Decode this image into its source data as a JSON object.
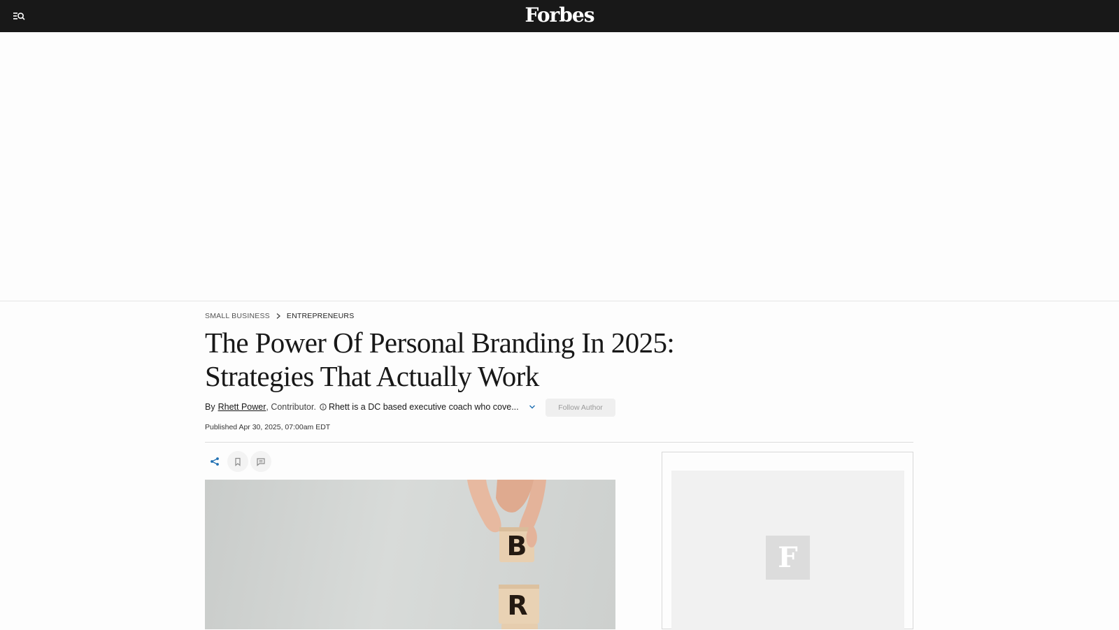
{
  "header": {
    "logo_text": "Forbes",
    "menu_icon": "menu-search-icon",
    "background": "#181818"
  },
  "breadcrumb": {
    "section": "SMALL BUSINESS",
    "separator_icon": "chevron-right-icon",
    "subsection": "ENTREPRENEURS"
  },
  "article": {
    "headline": "The Power Of Personal Branding In 2025: Strategies That Actually Work",
    "byline": {
      "prefix": "By",
      "author_name": "Rhett Power",
      "role": ", Contributor.",
      "info_icon": "info-circle-icon",
      "bio": "Rhett is a DC based executive coach who cove...",
      "expand_icon": "chevron-down-icon",
      "follow_label": "Follow Author"
    },
    "published": "Published Apr 30, 2025, 07:00am EDT",
    "actions": {
      "share_icon": "share-icon",
      "bookmark_icon": "bookmark-icon",
      "comment_icon": "comment-icon"
    },
    "hero_image": {
      "description_letters": [
        "B",
        "R"
      ],
      "alt_icon": "hero-image"
    }
  },
  "sidebar_ad": {
    "placeholder_logo": "F"
  },
  "colors": {
    "accent_share": "#1f6fb2",
    "follow_bg": "#efefef",
    "follow_text": "#9a9a9a"
  }
}
